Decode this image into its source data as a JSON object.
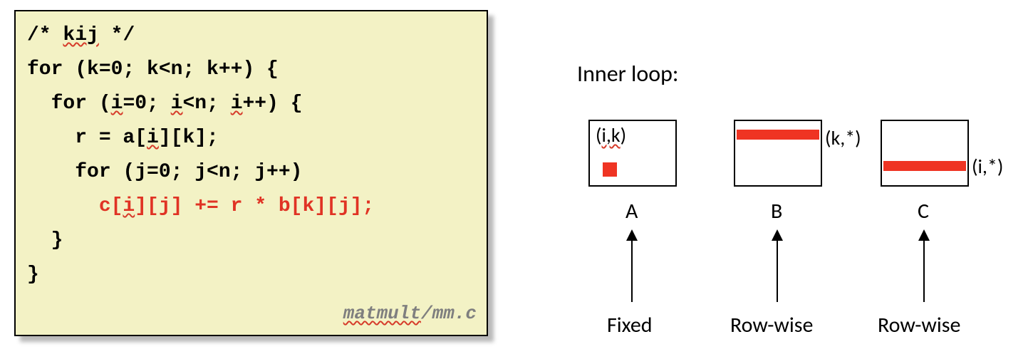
{
  "code": {
    "l1a": "/* ",
    "l1b": "kij",
    "l1c": " */",
    "l2": "for (k=0; k<n; k++) {",
    "l3a": "  for (",
    "l3b": "i",
    "l3c": "=0; ",
    "l3d": "i",
    "l3e": "<n; ",
    "l3f": "i",
    "l3g": "++) {",
    "l4a": "    r = a[",
    "l4b": "i",
    "l4c": "][k];",
    "l5": "    for (j=0; j<n; j++)",
    "l6a": "      c[",
    "l6b": "i",
    "l6c": "][j] += r * b[k][j];",
    "l7": "  }",
    "l8": "}",
    "file_a": "matmult",
    "file_b": "/mm.c"
  },
  "diagram": {
    "title": "Inner loop:",
    "ik": "(i,k)",
    "ks": "(k,*)",
    "is": "(i,*)",
    "A": "A",
    "B": "B",
    "C": "C",
    "descA": "Fixed",
    "descB": "Row-wise",
    "descC": "Row-wise"
  }
}
